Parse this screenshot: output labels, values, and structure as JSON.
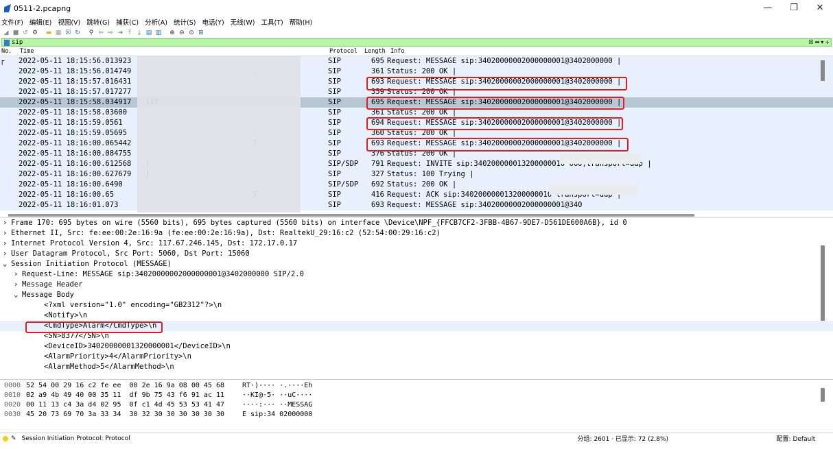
{
  "window": {
    "title": "0511-2.pcapng"
  },
  "menu": [
    "文件(F)",
    "编辑(E)",
    "视图(V)",
    "跳转(G)",
    "捕获(C)",
    "分析(A)",
    "统计(S)",
    "电话(Y)",
    "无线(W)",
    "工具(T)",
    "帮助(H)"
  ],
  "filter": {
    "value": "sip"
  },
  "columns": {
    "no": "No.",
    "time": "Time",
    "protocol": "Protocol",
    "length": "Length",
    "info": "Info"
  },
  "packets": [
    {
      "time": "2022-05-11 18:15:56.013923",
      "src": "",
      "dst": "",
      "proto": "SIP",
      "len": "695",
      "info": "Request: MESSAGE sip:34020000002000000001@3402000000 |"
    },
    {
      "time": "2022-05-11 18:15:56.014749",
      "src": "",
      "dst": ",",
      "proto": "SIP",
      "len": "361",
      "info": "Status: 200 OK |"
    },
    {
      "time": "2022-05-11 18:15:57.016431",
      "src": "",
      "dst": "",
      "proto": "SIP",
      "len": "693",
      "info": "Request: MESSAGE sip:34020000002000000001@3402000000 |"
    },
    {
      "time": "2022-05-11 18:15:57.017277",
      "src": "",
      "dst": "",
      "proto": "SIP",
      "len": "359",
      "info": "Status: 200 OK |"
    },
    {
      "time": "2022-05-11 18:15:58.034917",
      "src": "117",
      "dst": "",
      "proto": "SIP",
      "len": "695",
      "info": "Request: MESSAGE sip:34020000002000000001@3402000000 |"
    },
    {
      "time": "2022-05-11 18:15:58.03600",
      "src": "",
      "dst": "",
      "proto": "SIP",
      "len": "361",
      "info": "Status: 200 OK |"
    },
    {
      "time": "2022-05-11 18:15:59.0561",
      "src": "",
      "dst": "",
      "proto": "SIP",
      "len": "694",
      "info": "Request: MESSAGE sip:34020000002000000001@3402000000 |"
    },
    {
      "time": "2022-05-11 18:15:59.05695",
      "src": "",
      "dst": ".",
      "proto": "SIP",
      "len": "360",
      "info": "Status: 200 OK |"
    },
    {
      "time": "2022-05-11 18:16:00.065442",
      "src": "",
      "dst": "7",
      "proto": "SIP",
      "len": "693",
      "info": "Request: MESSAGE sip:34020000002000000001@3402000000 |"
    },
    {
      "time": "2022-05-11 18:16:00.084755",
      "src": "",
      "dst": "",
      "proto": "SIP",
      "len": "376",
      "info": "Status: 200 OK |"
    },
    {
      "time": "2022-05-11 18:16:00.612568",
      "src": "1",
      "dst": "",
      "proto": "SIP/SDP",
      "len": "791",
      "info": "Request: INVITE sip:340200000013200000010                    060;transport=udp |"
    },
    {
      "time": "2022-05-11 18:16:00.627679",
      "src": "1",
      "dst": "",
      "proto": "SIP",
      "len": "327",
      "info": "Status: 100 Trying |"
    },
    {
      "time": "2022-05-11 18:16:00.6490",
      "src": "",
      "dst": "",
      "proto": "SIP/SDP",
      "len": "692",
      "info": "Status: 200 OK |"
    },
    {
      "time": "2022-05-11 18:16:00.65",
      "src": "",
      "dst": "5",
      "proto": "SIP",
      "len": "416",
      "info": "Request: ACK sip:340200000013200000010                    transport=udp |"
    },
    {
      "time": "2022-05-11 18:16:01.073",
      "src": "",
      "dst": "",
      "proto": "SIP",
      "len": "693",
      "info": "Request: MESSAGE sip:34020000002000000001@340"
    }
  ],
  "details": [
    {
      "arrow": "›",
      "indent": 0,
      "text": "Frame 170: 695 bytes on wire (5560 bits), 695 bytes captured (5560 bits) on interface \\Device\\NPF_{FFCB7CF2-3FBB-4B67-9DE7-D561DE600A6B}, id 0"
    },
    {
      "arrow": "›",
      "indent": 0,
      "text": "Ethernet II, Src: fe:ee:00:2e:16:9a (fe:ee:00:2e:16:9a), Dst: RealtekU_29:16:c2 (52:54:00:29:16:c2)"
    },
    {
      "arrow": "›",
      "indent": 0,
      "text": "Internet Protocol Version 4, Src: 117.67.246.145, Dst: 172.17.0.17"
    },
    {
      "arrow": "›",
      "indent": 0,
      "text": "User Datagram Protocol, Src Port: 5060, Dst Port: 15060"
    },
    {
      "arrow": "⌄",
      "indent": 0,
      "text": "Session Initiation Protocol (MESSAGE)"
    },
    {
      "arrow": "›",
      "indent": 1,
      "text": "Request-Line: MESSAGE sip:34020000002000000001@3402000000 SIP/2.0"
    },
    {
      "arrow": "›",
      "indent": 1,
      "text": "Message Header"
    },
    {
      "arrow": "⌄",
      "indent": 1,
      "text": "Message Body"
    },
    {
      "arrow": "",
      "indent": 2,
      "text": "<?xml version=\"1.0\" encoding=\"GB2312\"?>\\n"
    },
    {
      "arrow": "",
      "indent": 2,
      "text": "<Notify>\\n"
    },
    {
      "arrow": "",
      "indent": 2,
      "text": "<CmdType>Alarm</CmdType>\\n"
    },
    {
      "arrow": "",
      "indent": 2,
      "text": "<SN>8377</SN>\\n"
    },
    {
      "arrow": "",
      "indent": 2,
      "text": "<DeviceID>34020000001320000001</DeviceID>\\n"
    },
    {
      "arrow": "",
      "indent": 2,
      "text": "<AlarmPriority>4</AlarmPriority>\\n"
    },
    {
      "arrow": "",
      "indent": 2,
      "text": "<AlarmMethod>5</AlarmMethod>\\n"
    }
  ],
  "hex": [
    {
      "off": "0000",
      "bytes": "52 54 00 29 16 c2 fe ee  00 2e 16 9a 08 00 45 68",
      "ascii": "RT·)···· ·.····Eh"
    },
    {
      "off": "0010",
      "bytes": "02 a9 4b 49 40 00 35 11  df 9b 75 43 f6 91 ac 11",
      "ascii": "··KI@·5· ··uC····"
    },
    {
      "off": "0020",
      "bytes": "00 11 13 c4 3a d4 02 95  0f c1 4d 45 53 53 41 47",
      "ascii": "····:··· ··MESSAG"
    },
    {
      "off": "0030",
      "bytes": "45 20 73 69 70 3a 33 34  30 32 30 30 30 30 30 30",
      "ascii": "E sip:34 02000000"
    }
  ],
  "status": {
    "left": "Session Initiation Protocol: Protocol",
    "packets": "分组: 2601 · 已显示: 72 (2.8%)",
    "profile": "配置: Default"
  }
}
